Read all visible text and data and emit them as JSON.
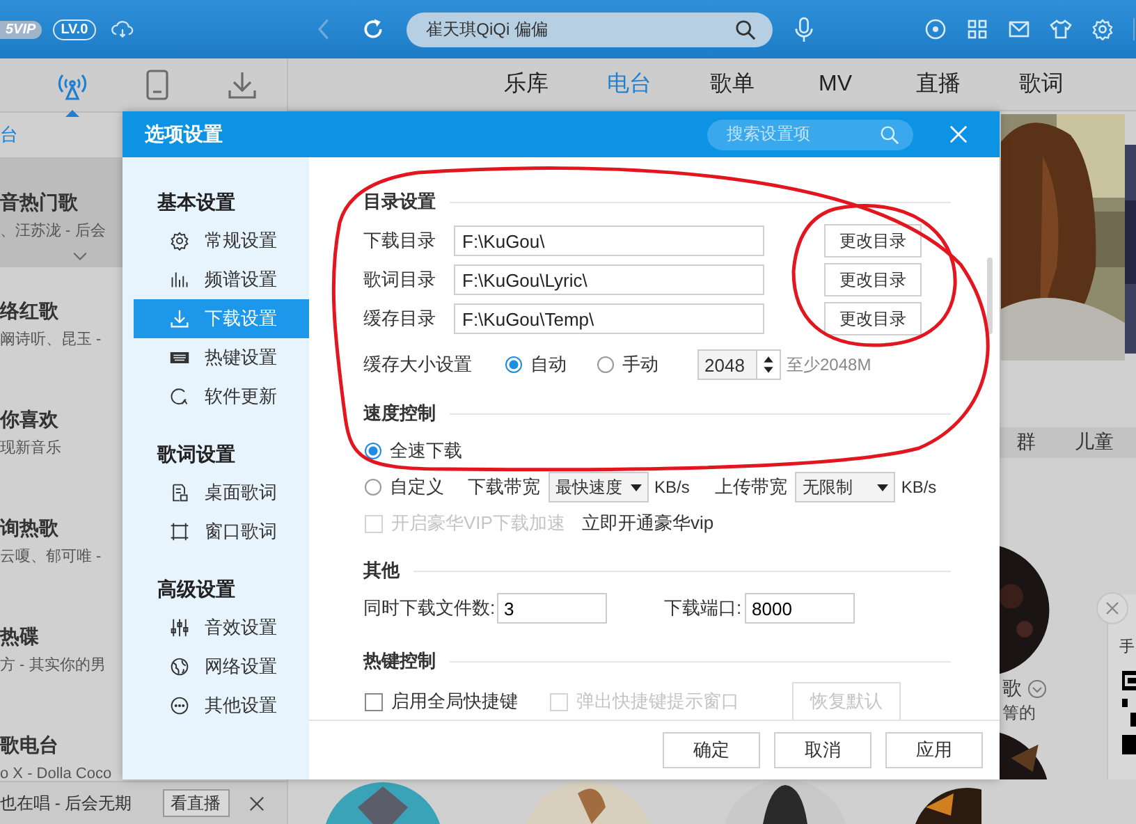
{
  "top_bar": {
    "vip_badge": "5VIP",
    "level_badge": "LV.0",
    "search": {
      "value": "崔天琪QiQi 偏偏"
    }
  },
  "side_nav": [
    {
      "selected": true
    },
    {
      "selected": false
    },
    {
      "selected": false
    }
  ],
  "tabs": [
    {
      "label": "乐库",
      "selected": false
    },
    {
      "label": "电台",
      "selected": true
    },
    {
      "label": "歌单",
      "selected": false
    },
    {
      "label": "MV",
      "selected": false
    },
    {
      "label": "直播",
      "selected": false
    },
    {
      "label": "歌词",
      "selected": false
    }
  ],
  "left_list": {
    "header": "台",
    "items": [
      {
        "title": "音热门歌",
        "subtitle": "、汪苏泷 - 后会",
        "selected": true
      },
      {
        "title": "络红歌",
        "subtitle": "阚诗听、昆玉 -",
        "selected": false
      },
      {
        "title": "你喜欢",
        "subtitle": "现新音乐",
        "selected": false
      },
      {
        "title": "询热歌",
        "subtitle": "云嗄、郁可唯 -",
        "selected": false
      },
      {
        "title": "热碟",
        "subtitle": "方 - 其实你的男",
        "selected": false
      },
      {
        "title": "歌电台",
        "subtitle": "o X - Dolla Coco",
        "selected": false
      }
    ]
  },
  "now_playing": {
    "text": "也在唱 - 后会无期",
    "button": "看直播"
  },
  "right_panel": {
    "categories": [
      "群",
      "儿童"
    ],
    "card_title": "歌",
    "card_subtitle": "箐的",
    "popup_text": "手"
  },
  "dialog": {
    "title": "选项设置",
    "search_placeholder": "搜索设置项",
    "sidebar": [
      {
        "title": "基本设置",
        "items": [
          {
            "label": "常规设置",
            "selected": false
          },
          {
            "label": "频谱设置",
            "selected": false
          },
          {
            "label": "下载设置",
            "selected": true
          },
          {
            "label": "热键设置",
            "selected": false
          },
          {
            "label": "软件更新",
            "selected": false
          }
        ]
      },
      {
        "title": "歌词设置",
        "items": [
          {
            "label": "桌面歌词",
            "selected": false
          },
          {
            "label": "窗口歌词",
            "selected": false
          }
        ]
      },
      {
        "title": "高级设置",
        "items": [
          {
            "label": "音效设置",
            "selected": false
          },
          {
            "label": "网络设置",
            "selected": false
          },
          {
            "label": "其他设置",
            "selected": false
          }
        ]
      }
    ],
    "directory": {
      "title": "目录设置",
      "rows": [
        {
          "label": "下载目录",
          "value": "F:\\KuGou\\",
          "button": "更改目录"
        },
        {
          "label": "歌词目录",
          "value": "F:\\KuGou\\Lyric\\",
          "button": "更改目录"
        },
        {
          "label": "缓存目录",
          "value": "F:\\KuGou\\Temp\\",
          "button": "更改目录"
        }
      ],
      "cache": {
        "label": "缓存大小设置",
        "options": [
          {
            "label": "自动",
            "selected": true
          },
          {
            "label": "手动",
            "selected": false
          }
        ],
        "value": "2048",
        "hint": "至少2048M"
      }
    },
    "speed": {
      "title": "速度控制",
      "options": [
        {
          "label": "全速下载",
          "selected": true
        },
        {
          "label": "自定义",
          "selected": false
        }
      ],
      "download_label": "下载带宽",
      "download_select": "最快速度",
      "download_unit": "KB/s",
      "upload_label": "上传带宽",
      "upload_select": "无限制",
      "upload_unit": "KB/s",
      "vip_checkbox": {
        "label": "开启豪华VIP下载加速",
        "checked": false,
        "disabled": true
      },
      "vip_link": "立即开通豪华vip"
    },
    "other": {
      "title": "其他",
      "fields": [
        {
          "label": "同时下载文件数:",
          "value": "3"
        },
        {
          "label": "下载端口:",
          "value": "8000"
        }
      ]
    },
    "hotkey": {
      "title": "热键控制",
      "checkboxes": [
        {
          "label": "启用全局快捷键",
          "checked": false,
          "disabled": false
        },
        {
          "label": "弹出快捷键提示窗口",
          "checked": false,
          "disabled": true
        }
      ],
      "button": {
        "label": "恢复默认",
        "disabled": true
      }
    },
    "buttons": [
      "确定",
      "取消",
      "应用"
    ]
  }
}
